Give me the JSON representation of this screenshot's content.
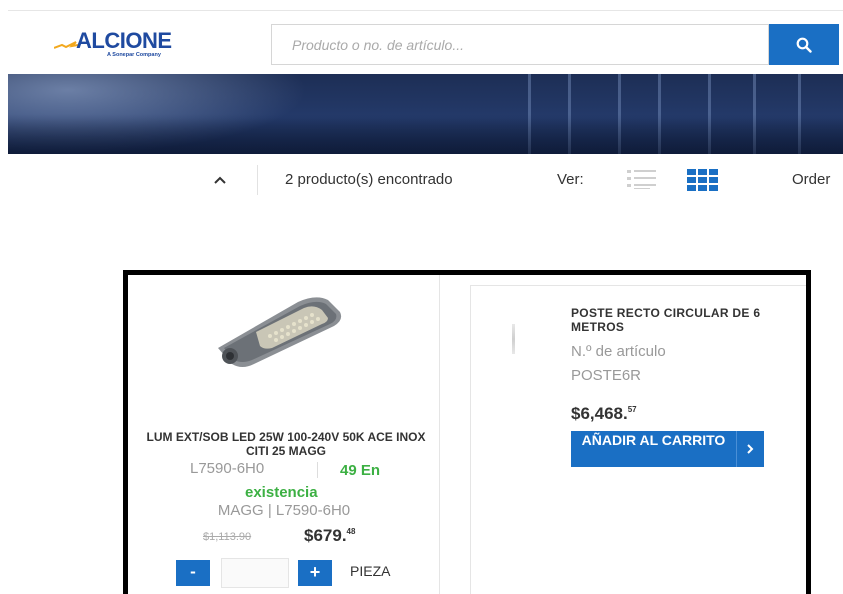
{
  "header": {
    "logo_text": "ALCIONE",
    "logo_tagline": "A Sonepar Company",
    "search_placeholder": "Producto o no. de artículo...",
    "accent_color": "#1a6fc4"
  },
  "toolbar": {
    "results_text": "2 producto(s) encontrado",
    "view_label": "Ver:",
    "order_label": "Order"
  },
  "products": [
    {
      "name": "LUM EXT/SOB LED 25W 100-240V 50K ACE INOX CITI 25 MAGG",
      "sku": "L7590-6H0",
      "stock_line1": "49 En",
      "stock_line2": "existencia",
      "brand_line": "MAGG | L7590-6H0",
      "old_price": "$1,113.90",
      "price_main": "$679.",
      "price_cents": "48",
      "qty_minus": "-",
      "qty_plus": "+",
      "unit": "PIEZA"
    },
    {
      "name": "POSTE RECTO CIRCULAR DE 6 METROS",
      "sku_label": "N.º de artículo",
      "sku": "POSTE6R",
      "price_main": "$6,468.",
      "price_cents": "57",
      "cart_label": "AÑADIR AL CARRITO"
    }
  ]
}
